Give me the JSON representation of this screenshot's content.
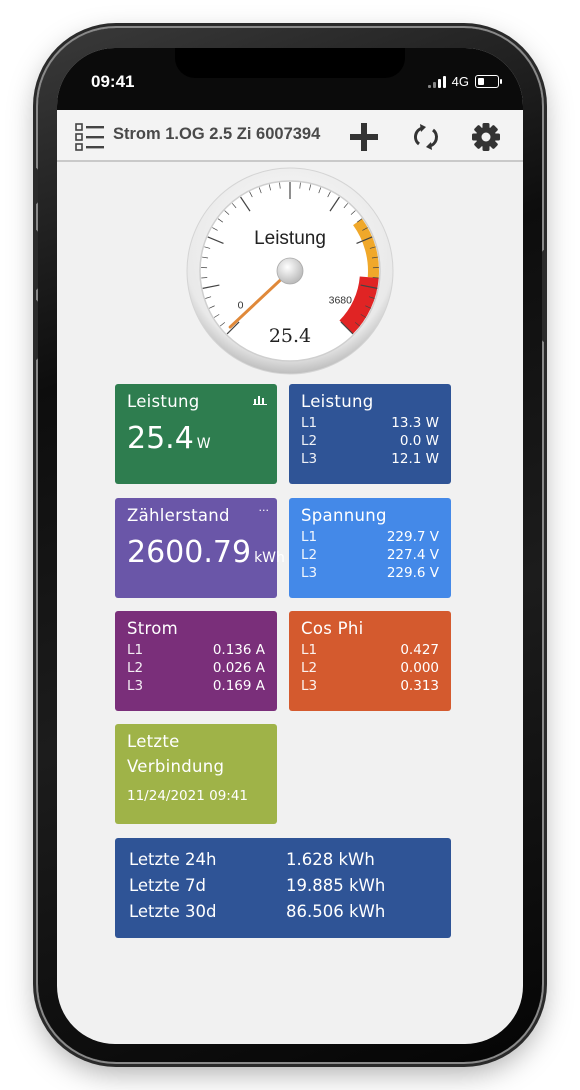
{
  "status_bar": {
    "time": "09:41",
    "network": "4G"
  },
  "toolbar": {
    "title": "Strom 1.OG 2.5 Zi 6007394"
  },
  "gauge": {
    "label": "Leistung",
    "min_label": "0",
    "max_label": "3680",
    "value_text": "25.4",
    "value": 25.4,
    "max": 3680
  },
  "tiles": {
    "leistung_big": {
      "title": "Leistung",
      "value": "25.4",
      "unit": "W"
    },
    "leistung_phases": {
      "title": "Leistung",
      "rows": [
        {
          "label": "L1",
          "value": "13.3 W"
        },
        {
          "label": "L2",
          "value": "0.0 W"
        },
        {
          "label": "L3",
          "value": "12.1 W"
        }
      ]
    },
    "zaehlerstand": {
      "title": "Zählerstand",
      "value": "2600.79",
      "unit": "kWh",
      "more": "···"
    },
    "spannung": {
      "title": "Spannung",
      "rows": [
        {
          "label": "L1",
          "value": "229.7 V"
        },
        {
          "label": "L2",
          "value": "227.4 V"
        },
        {
          "label": "L3",
          "value": "229.6 V"
        }
      ]
    },
    "strom": {
      "title": "Strom",
      "rows": [
        {
          "label": "L1",
          "value": "0.136 A"
        },
        {
          "label": "L2",
          "value": "0.026 A"
        },
        {
          "label": "L3",
          "value": "0.169 A"
        }
      ]
    },
    "cosphi": {
      "title": "Cos Phi",
      "rows": [
        {
          "label": "L1",
          "value": "0.427"
        },
        {
          "label": "L2",
          "value": "0.000"
        },
        {
          "label": "L3",
          "value": "0.313"
        }
      ]
    },
    "letzte_verbindung": {
      "title_line1": "Letzte",
      "title_line2": "Verbindung",
      "value": "11/24/2021 09:41"
    }
  },
  "summary": {
    "rows": [
      {
        "label": "Letzte 24h",
        "value": "1.628 kWh"
      },
      {
        "label": "Letzte 7d",
        "value": "19.885 kWh"
      },
      {
        "label": "Letzte 30d",
        "value": "86.506 kWh"
      }
    ]
  },
  "colors": {
    "leistung_big": "#2e7d4f",
    "leistung_phases": "#2f5496",
    "zaehlerstand": "#6a56a8",
    "spannung": "#4489e8",
    "strom": "#7a2f7a",
    "cosphi": "#d45a2e",
    "letzte_verbindung": "#9fb348",
    "summary": "#2f5496",
    "gauge_orange": "#f0a82a",
    "gauge_red": "#e02424"
  }
}
